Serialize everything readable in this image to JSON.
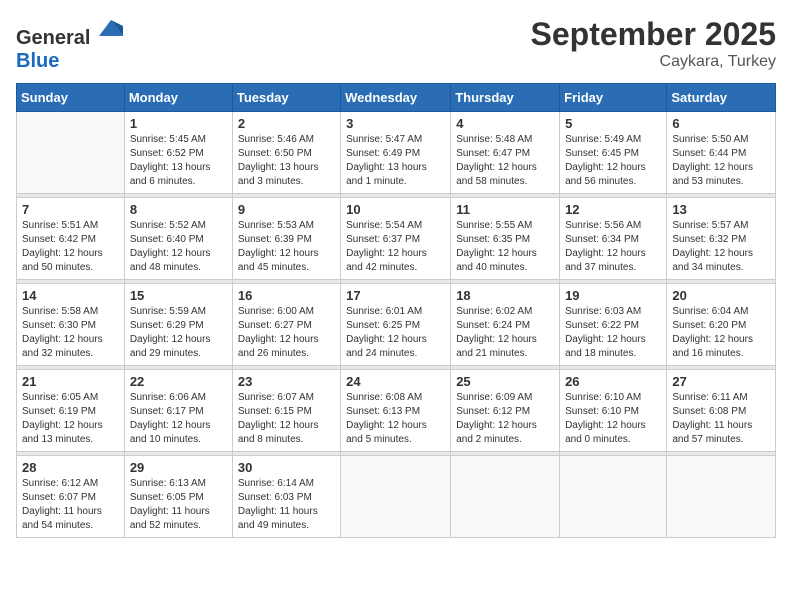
{
  "logo": {
    "general": "General",
    "blue": "Blue"
  },
  "header": {
    "month": "September 2025",
    "location": "Caykara, Turkey"
  },
  "weekdays": [
    "Sunday",
    "Monday",
    "Tuesday",
    "Wednesday",
    "Thursday",
    "Friday",
    "Saturday"
  ],
  "weeks": [
    [
      {
        "day": "",
        "sunrise": "",
        "sunset": "",
        "daylight": ""
      },
      {
        "day": "1",
        "sunrise": "Sunrise: 5:45 AM",
        "sunset": "Sunset: 6:52 PM",
        "daylight": "Daylight: 13 hours and 6 minutes."
      },
      {
        "day": "2",
        "sunrise": "Sunrise: 5:46 AM",
        "sunset": "Sunset: 6:50 PM",
        "daylight": "Daylight: 13 hours and 3 minutes."
      },
      {
        "day": "3",
        "sunrise": "Sunrise: 5:47 AM",
        "sunset": "Sunset: 6:49 PM",
        "daylight": "Daylight: 13 hours and 1 minute."
      },
      {
        "day": "4",
        "sunrise": "Sunrise: 5:48 AM",
        "sunset": "Sunset: 6:47 PM",
        "daylight": "Daylight: 12 hours and 58 minutes."
      },
      {
        "day": "5",
        "sunrise": "Sunrise: 5:49 AM",
        "sunset": "Sunset: 6:45 PM",
        "daylight": "Daylight: 12 hours and 56 minutes."
      },
      {
        "day": "6",
        "sunrise": "Sunrise: 5:50 AM",
        "sunset": "Sunset: 6:44 PM",
        "daylight": "Daylight: 12 hours and 53 minutes."
      }
    ],
    [
      {
        "day": "7",
        "sunrise": "Sunrise: 5:51 AM",
        "sunset": "Sunset: 6:42 PM",
        "daylight": "Daylight: 12 hours and 50 minutes."
      },
      {
        "day": "8",
        "sunrise": "Sunrise: 5:52 AM",
        "sunset": "Sunset: 6:40 PM",
        "daylight": "Daylight: 12 hours and 48 minutes."
      },
      {
        "day": "9",
        "sunrise": "Sunrise: 5:53 AM",
        "sunset": "Sunset: 6:39 PM",
        "daylight": "Daylight: 12 hours and 45 minutes."
      },
      {
        "day": "10",
        "sunrise": "Sunrise: 5:54 AM",
        "sunset": "Sunset: 6:37 PM",
        "daylight": "Daylight: 12 hours and 42 minutes."
      },
      {
        "day": "11",
        "sunrise": "Sunrise: 5:55 AM",
        "sunset": "Sunset: 6:35 PM",
        "daylight": "Daylight: 12 hours and 40 minutes."
      },
      {
        "day": "12",
        "sunrise": "Sunrise: 5:56 AM",
        "sunset": "Sunset: 6:34 PM",
        "daylight": "Daylight: 12 hours and 37 minutes."
      },
      {
        "day": "13",
        "sunrise": "Sunrise: 5:57 AM",
        "sunset": "Sunset: 6:32 PM",
        "daylight": "Daylight: 12 hours and 34 minutes."
      }
    ],
    [
      {
        "day": "14",
        "sunrise": "Sunrise: 5:58 AM",
        "sunset": "Sunset: 6:30 PM",
        "daylight": "Daylight: 12 hours and 32 minutes."
      },
      {
        "day": "15",
        "sunrise": "Sunrise: 5:59 AM",
        "sunset": "Sunset: 6:29 PM",
        "daylight": "Daylight: 12 hours and 29 minutes."
      },
      {
        "day": "16",
        "sunrise": "Sunrise: 6:00 AM",
        "sunset": "Sunset: 6:27 PM",
        "daylight": "Daylight: 12 hours and 26 minutes."
      },
      {
        "day": "17",
        "sunrise": "Sunrise: 6:01 AM",
        "sunset": "Sunset: 6:25 PM",
        "daylight": "Daylight: 12 hours and 24 minutes."
      },
      {
        "day": "18",
        "sunrise": "Sunrise: 6:02 AM",
        "sunset": "Sunset: 6:24 PM",
        "daylight": "Daylight: 12 hours and 21 minutes."
      },
      {
        "day": "19",
        "sunrise": "Sunrise: 6:03 AM",
        "sunset": "Sunset: 6:22 PM",
        "daylight": "Daylight: 12 hours and 18 minutes."
      },
      {
        "day": "20",
        "sunrise": "Sunrise: 6:04 AM",
        "sunset": "Sunset: 6:20 PM",
        "daylight": "Daylight: 12 hours and 16 minutes."
      }
    ],
    [
      {
        "day": "21",
        "sunrise": "Sunrise: 6:05 AM",
        "sunset": "Sunset: 6:19 PM",
        "daylight": "Daylight: 12 hours and 13 minutes."
      },
      {
        "day": "22",
        "sunrise": "Sunrise: 6:06 AM",
        "sunset": "Sunset: 6:17 PM",
        "daylight": "Daylight: 12 hours and 10 minutes."
      },
      {
        "day": "23",
        "sunrise": "Sunrise: 6:07 AM",
        "sunset": "Sunset: 6:15 PM",
        "daylight": "Daylight: 12 hours and 8 minutes."
      },
      {
        "day": "24",
        "sunrise": "Sunrise: 6:08 AM",
        "sunset": "Sunset: 6:13 PM",
        "daylight": "Daylight: 12 hours and 5 minutes."
      },
      {
        "day": "25",
        "sunrise": "Sunrise: 6:09 AM",
        "sunset": "Sunset: 6:12 PM",
        "daylight": "Daylight: 12 hours and 2 minutes."
      },
      {
        "day": "26",
        "sunrise": "Sunrise: 6:10 AM",
        "sunset": "Sunset: 6:10 PM",
        "daylight": "Daylight: 12 hours and 0 minutes."
      },
      {
        "day": "27",
        "sunrise": "Sunrise: 6:11 AM",
        "sunset": "Sunset: 6:08 PM",
        "daylight": "Daylight: 11 hours and 57 minutes."
      }
    ],
    [
      {
        "day": "28",
        "sunrise": "Sunrise: 6:12 AM",
        "sunset": "Sunset: 6:07 PM",
        "daylight": "Daylight: 11 hours and 54 minutes."
      },
      {
        "day": "29",
        "sunrise": "Sunrise: 6:13 AM",
        "sunset": "Sunset: 6:05 PM",
        "daylight": "Daylight: 11 hours and 52 minutes."
      },
      {
        "day": "30",
        "sunrise": "Sunrise: 6:14 AM",
        "sunset": "Sunset: 6:03 PM",
        "daylight": "Daylight: 11 hours and 49 minutes."
      },
      {
        "day": "",
        "sunrise": "",
        "sunset": "",
        "daylight": ""
      },
      {
        "day": "",
        "sunrise": "",
        "sunset": "",
        "daylight": ""
      },
      {
        "day": "",
        "sunrise": "",
        "sunset": "",
        "daylight": ""
      },
      {
        "day": "",
        "sunrise": "",
        "sunset": "",
        "daylight": ""
      }
    ]
  ]
}
